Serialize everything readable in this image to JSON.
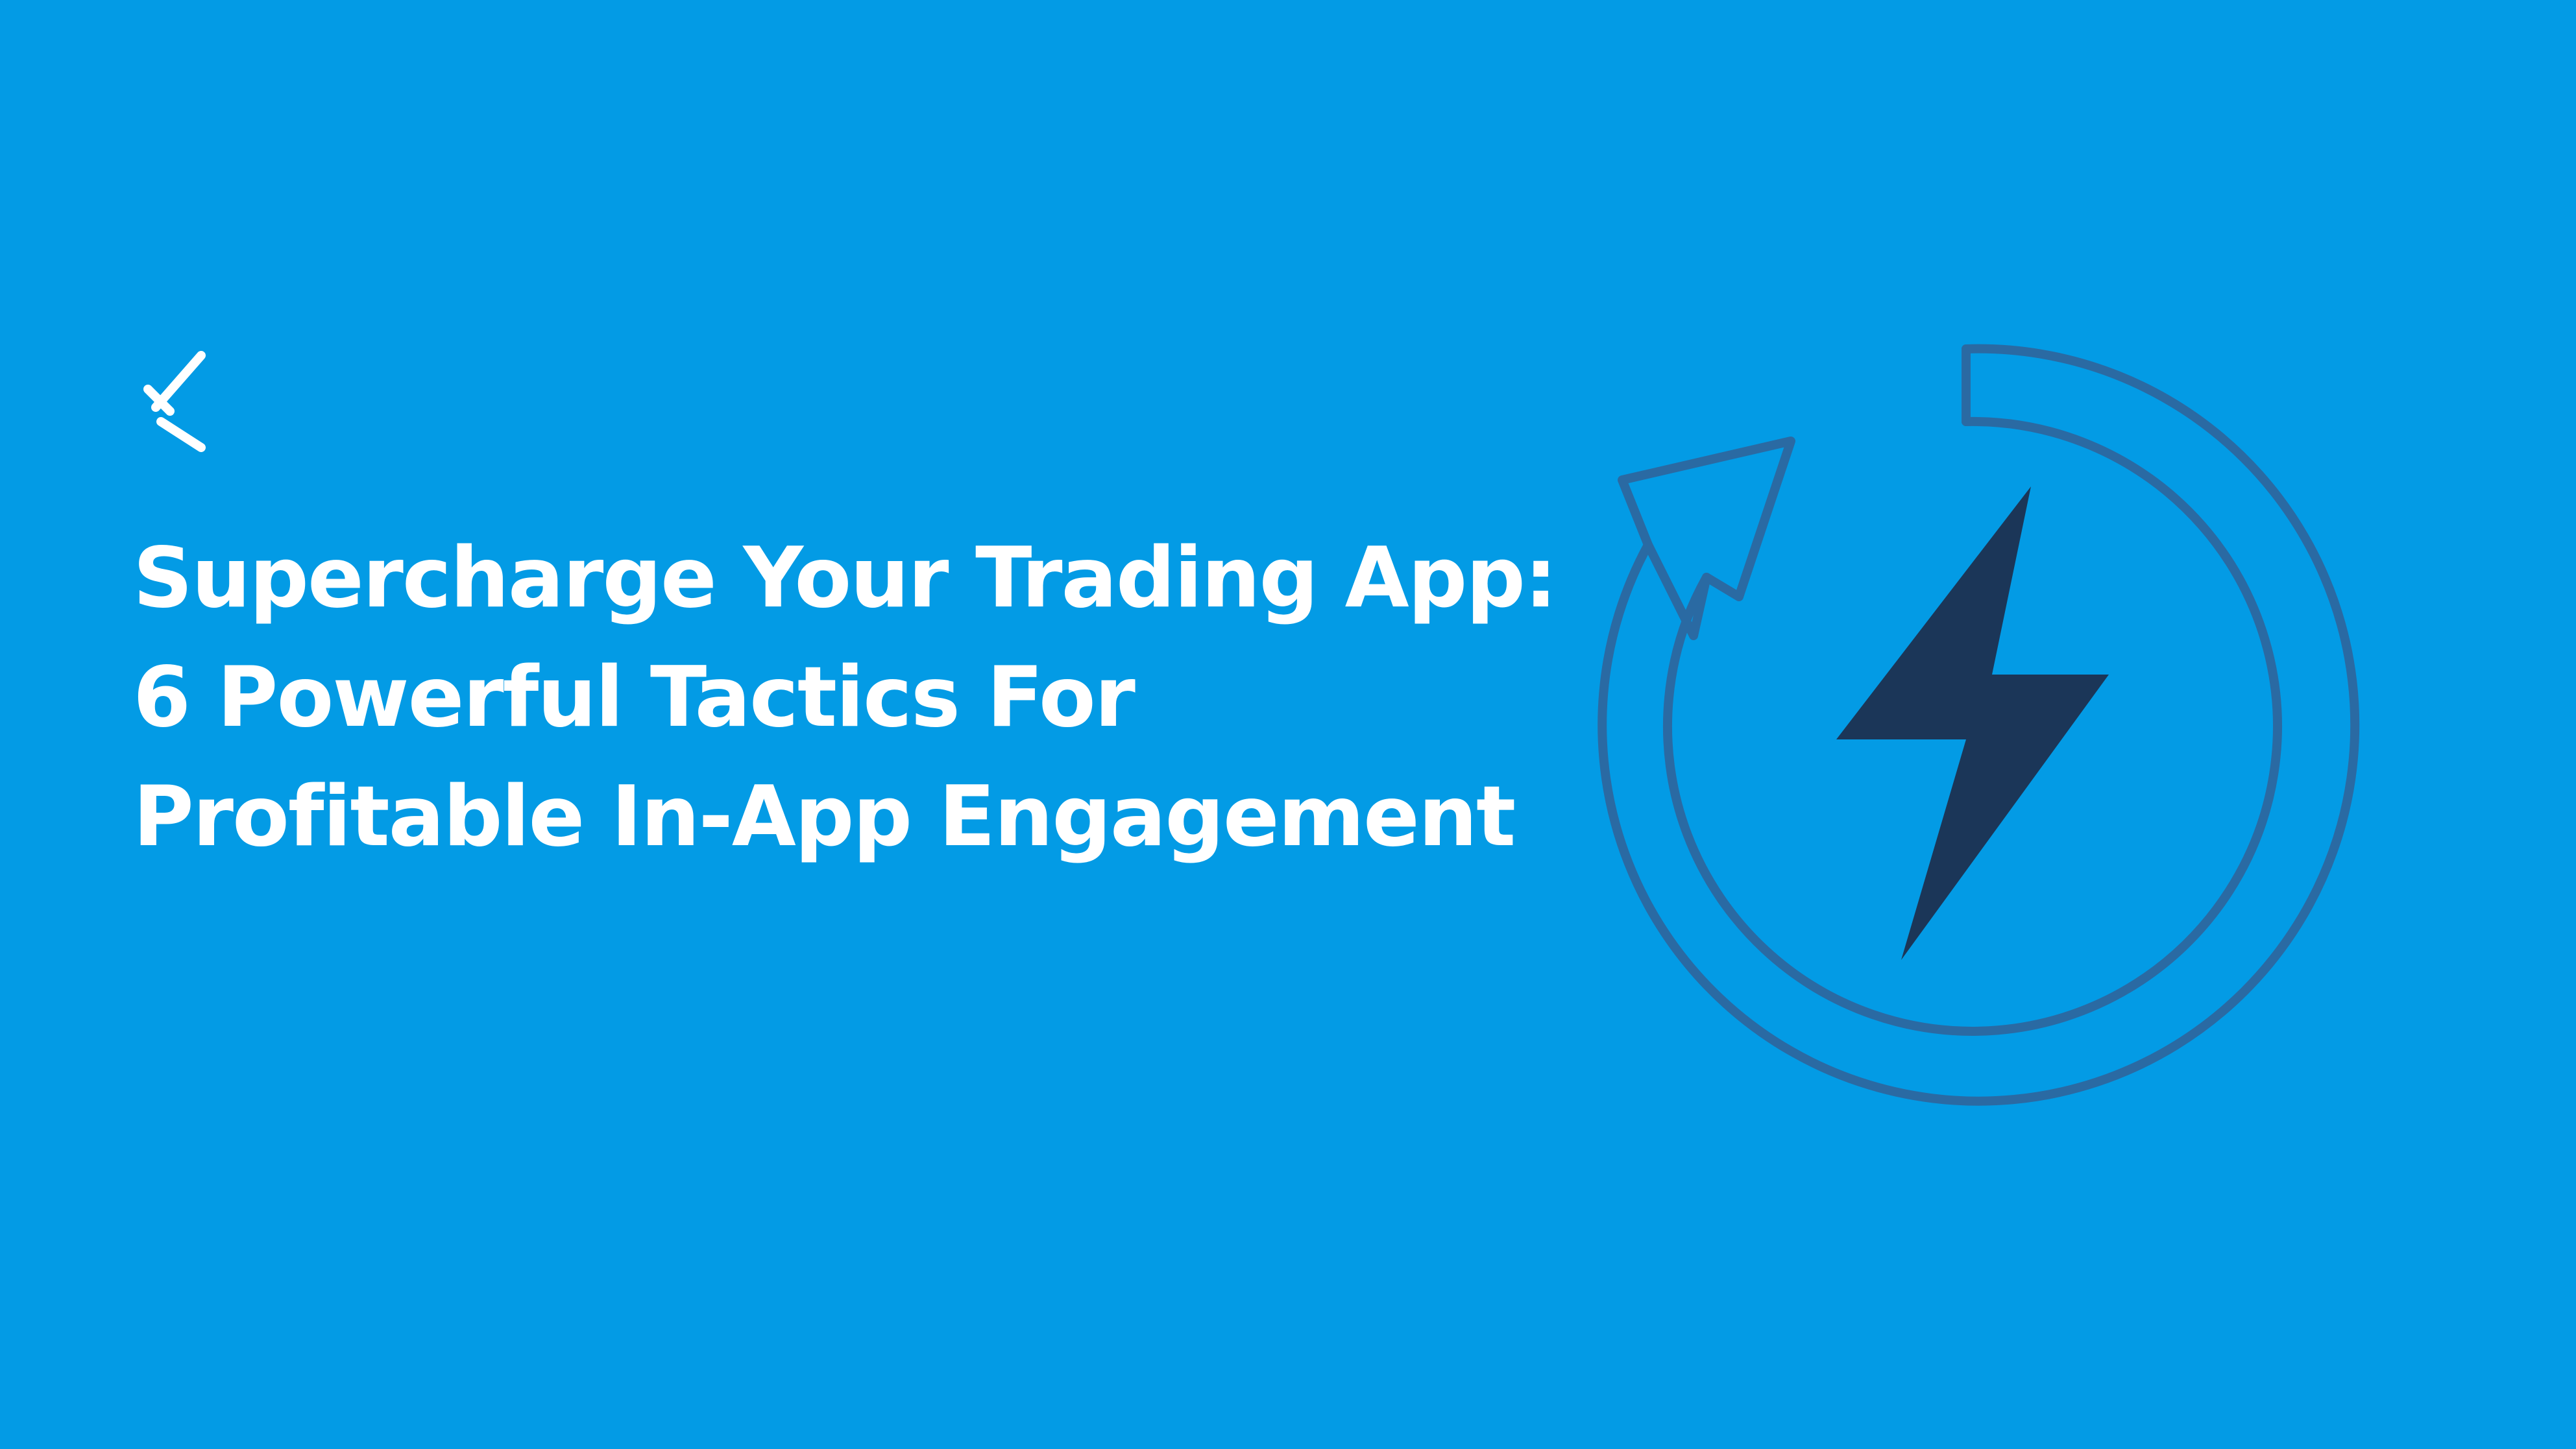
{
  "headline": {
    "line1": "Supercharge Your Trading App:",
    "line2": "6 Powerful Tactics For",
    "line3": "Profitable In-App Engagement"
  },
  "logo": {
    "icon": "brand-logo-icon"
  },
  "illustration": {
    "icon": "lightning-refresh-icon",
    "parts": [
      "refresh-arrow-icon",
      "lightning-bolt-icon"
    ]
  },
  "colors": {
    "background": "#039be5",
    "text": "#ffffff",
    "outline": "#2a6aa3",
    "bolt": "#1b3658"
  }
}
